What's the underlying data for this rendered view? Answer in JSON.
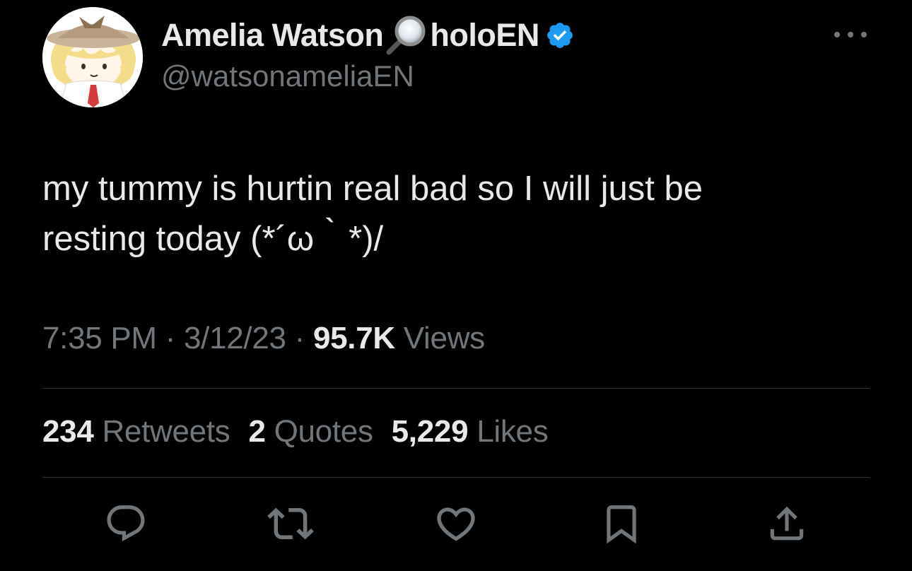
{
  "author": {
    "display_name": "Amelia Watson",
    "name_suffix": "holoEN",
    "handle": "@watsonameliaEN",
    "verified_color": "#1d9bf0"
  },
  "tweet": {
    "text_line1": "my tummy is hurtin real bad so I will just be",
    "text_line2": "resting today (*´ω｀*)/"
  },
  "meta": {
    "time": "7:35 PM",
    "separator": "·",
    "date": "3/12/23",
    "views_count": "95.7K",
    "views_label": "Views"
  },
  "stats": {
    "retweets_count": "234",
    "retweets_label": "Retweets",
    "quotes_count": "2",
    "quotes_label": "Quotes",
    "likes_count": "5,229",
    "likes_label": "Likes"
  },
  "actions": [
    "reply-icon",
    "retweet-icon",
    "like-icon",
    "bookmark-icon",
    "share-icon"
  ],
  "colors": {
    "background": "#000000",
    "text_primary": "#e7e9ea",
    "text_secondary": "#71767b",
    "divider": "#2f3336",
    "verified": "#1d9bf0"
  }
}
